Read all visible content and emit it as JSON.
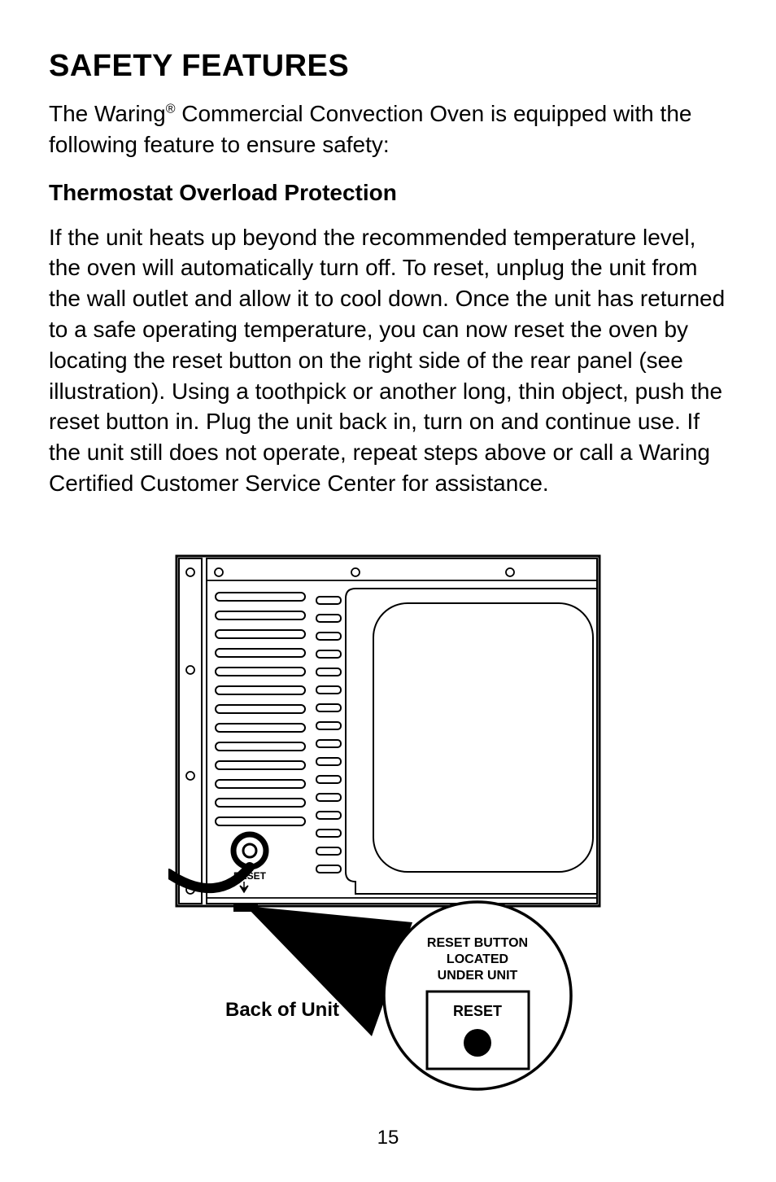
{
  "title": "SAFETY FEATURES",
  "intro_pre": "The Waring",
  "intro_sup": "®",
  "intro_post": " Commercial Convection Oven is equipped with the following feature to ensure safety:",
  "subheading": "Thermostat Overload Protection",
  "body": "If the unit heats up beyond the recommended temperature level, the oven will automatically turn off. To reset, unplug the unit from the wall outlet and allow it to cool down. Once the unit has returned to a safe operating temperature, you can now reset the oven by locating the reset button on the right side of the rear panel (see illustration). Using a toothpick or another long, thin object, push the reset button in. Plug the unit back in, turn on and continue use. If the unit still does not operate, repeat steps above or call a Waring Certified Customer Service Center for assistance.",
  "diagram": {
    "reset_label": "RESET",
    "reset_arrow_label": "RESET",
    "callout_line1": "RESET BUTTON",
    "callout_line2": "LOCATED",
    "callout_line3": "UNDER UNIT",
    "callout_reset": "RESET",
    "back_label": "Back of Unit"
  },
  "page_number": "15"
}
